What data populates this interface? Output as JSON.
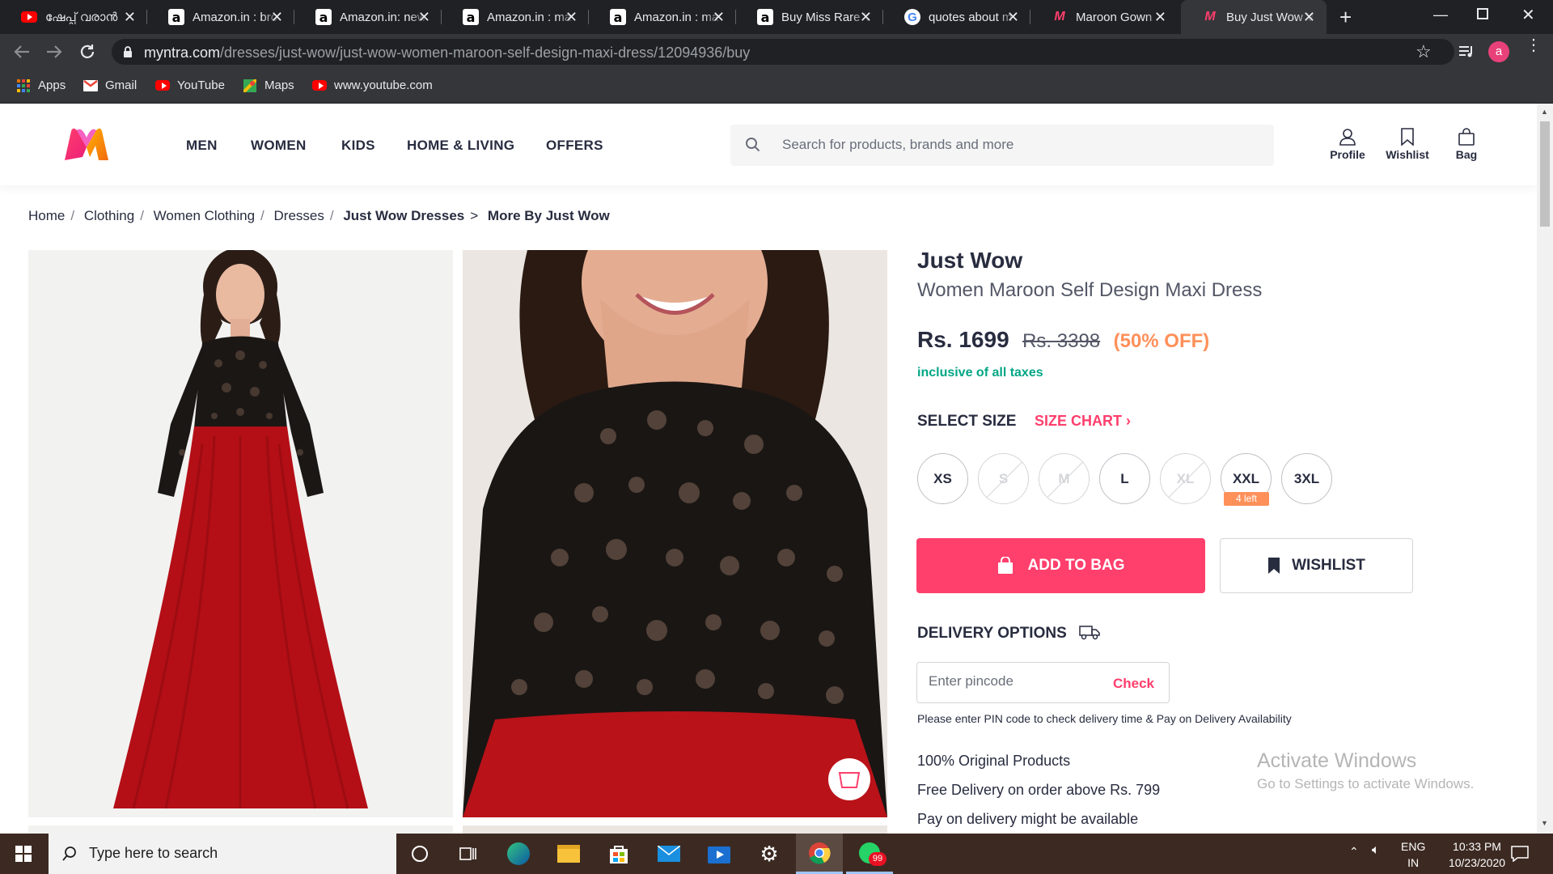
{
  "browser": {
    "tabs": [
      {
        "title": "ഷേപ്പ് വരാൻ",
        "favicon": "youtube-icon"
      },
      {
        "title": "Amazon.in : bro",
        "favicon": "amazon-icon"
      },
      {
        "title": "Amazon.in: new",
        "favicon": "amazon-icon"
      },
      {
        "title": "Amazon.in : ma",
        "favicon": "amazon-icon"
      },
      {
        "title": "Amazon.in : ma",
        "favicon": "amazon-icon"
      },
      {
        "title": "Buy Miss Rare V",
        "favicon": "amazon-icon"
      },
      {
        "title": "quotes about m",
        "favicon": "google-icon"
      },
      {
        "title": "Maroon Gown",
        "favicon": "myntra-icon"
      },
      {
        "title": "Buy Just Wow V",
        "favicon": "myntra-icon"
      }
    ],
    "url_host": "myntra.com",
    "url_path": "/dresses/just-wow/just-wow-women-maroon-self-design-maxi-dress/12094936/buy",
    "profile_initial": "a",
    "bookmarks": [
      {
        "label": "Apps",
        "icon": "apps-grid-icon"
      },
      {
        "label": "Gmail",
        "icon": "gmail-icon"
      },
      {
        "label": "YouTube",
        "icon": "youtube-icon"
      },
      {
        "label": "Maps",
        "icon": "maps-icon"
      },
      {
        "label": "www.youtube.com",
        "icon": "youtube-icon"
      }
    ]
  },
  "header": {
    "nav": [
      "MEN",
      "WOMEN",
      "KIDS",
      "HOME & LIVING",
      "OFFERS"
    ],
    "search_placeholder": "Search for products, brands and more",
    "actions": [
      "Profile",
      "Wishlist",
      "Bag"
    ]
  },
  "breadcrumb": {
    "items": [
      "Home",
      "Clothing",
      "Women Clothing",
      "Dresses"
    ],
    "current": "Just Wow Dresses",
    "more": "More By Just Wow"
  },
  "product": {
    "brand": "Just Wow",
    "name": "Women Maroon Self Design Maxi Dress",
    "price": "Rs. 1699",
    "mrp": "Rs. 3398",
    "discount": "(50% OFF)",
    "tax_note": "inclusive of all taxes",
    "select_size_label": "SELECT SIZE",
    "size_chart_label": "SIZE CHART",
    "sizes": [
      {
        "label": "XS",
        "available": true
      },
      {
        "label": "S",
        "available": false
      },
      {
        "label": "M",
        "available": false
      },
      {
        "label": "L",
        "available": true
      },
      {
        "label": "XL",
        "available": false
      },
      {
        "label": "XXL",
        "available": true,
        "tag": "4 left"
      },
      {
        "label": "3XL",
        "available": true
      }
    ],
    "add_to_bag": "ADD TO BAG",
    "wishlist": "WISHLIST"
  },
  "delivery": {
    "title": "DELIVERY OPTIONS",
    "pincode_placeholder": "Enter pincode",
    "check_label": "Check",
    "note": "Please enter PIN code to check delivery time & Pay on Delivery Availability",
    "features": [
      "100% Original Products",
      "Free Delivery on order above Rs. 799",
      "Pay on delivery might be available"
    ]
  },
  "watermark": {
    "line1": "Activate Windows",
    "line2": "Go to Settings to activate Windows."
  },
  "taskbar": {
    "search_placeholder": "Type here to search",
    "whatsapp_badge": "99",
    "lang_line1": "ENG",
    "lang_line2": "IN",
    "time": "10:33 PM",
    "date": "10/23/2020"
  },
  "colors": {
    "brand_pink": "#ff3f6c",
    "discount_orange": "#ff905a",
    "tax_green": "#03a685",
    "text_dark": "#282c3f"
  }
}
